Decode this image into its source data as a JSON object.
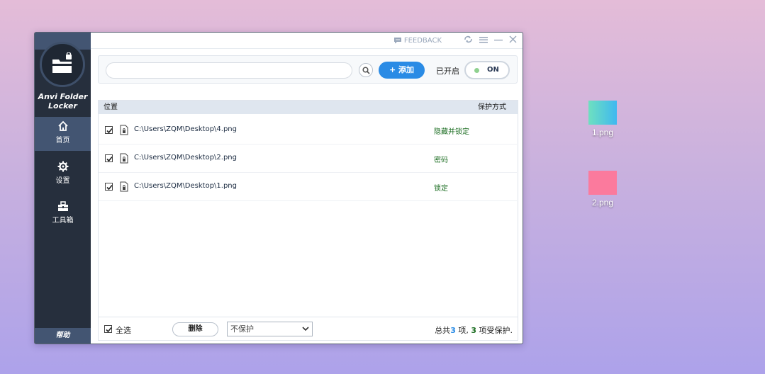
{
  "app": {
    "name_line1": "Anvi Folder",
    "name_line2": "Locker",
    "feedback": "FEEDBACK"
  },
  "sidebar": {
    "items": [
      {
        "label": "首页",
        "icon": "home-icon",
        "active": true
      },
      {
        "label": "设置",
        "icon": "gear-icon",
        "active": false
      },
      {
        "label": "工具箱",
        "icon": "toolbox-icon",
        "active": false
      }
    ],
    "bottom_label": "帮助"
  },
  "toolbar": {
    "search_placeholder": "",
    "add_label": "+ 添加",
    "status_label": "已开启",
    "toggle_label": "ON"
  },
  "table": {
    "headers": {
      "path": "位置",
      "mode": "保护方式"
    },
    "rows": [
      {
        "checked": true,
        "path": "C:\\Users\\ZQM\\Desktop\\4.png",
        "mode": "隐藏并锁定"
      },
      {
        "checked": true,
        "path": "C:\\Users\\ZQM\\Desktop\\2.png",
        "mode": "密码"
      },
      {
        "checked": true,
        "path": "C:\\Users\\ZQM\\Desktop\\1.png",
        "mode": "锁定"
      }
    ]
  },
  "footer": {
    "select_all": "全选",
    "delete": "删除",
    "protection_option": "不保护",
    "summary_prefix": "总共",
    "total": "3",
    "summary_mid": " 项, ",
    "protected": "3",
    "summary_suffix": " 项受保护."
  },
  "desktop": {
    "icons": [
      {
        "name": "1.png",
        "color_from": "#6ee0c0",
        "color_to": "#3fb8f0"
      },
      {
        "name": "2.png",
        "color_from": "#fb7a9d",
        "color_to": "#fb7a9d"
      }
    ]
  },
  "colors": {
    "accent": "#2a8be5",
    "sidebar": "#262f3d",
    "sidebar_active": "#435572",
    "mode_text": "#1d6e23"
  }
}
